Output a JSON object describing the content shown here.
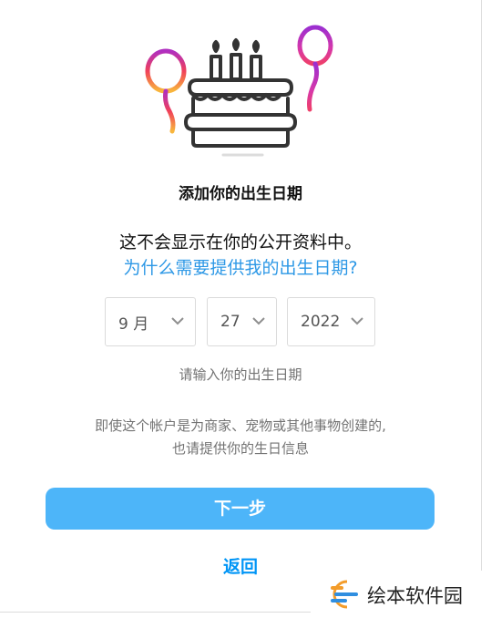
{
  "title": "添加你的出生日期",
  "description": "这不会显示在你的公开资料中。",
  "why_link": "为什么需要提供我的出生日期?",
  "birthday": {
    "month": "9 月",
    "day": "27",
    "year": "2022"
  },
  "hint": "请输入你的出生日期",
  "note_line1": "即使这个帐户是为商家、宠物或其他事物创建的,",
  "note_line2": "也请提供你的生日信息",
  "next_button": "下一步",
  "back_link": "返回",
  "watermark_text": "绘本软件园",
  "icons": {
    "illustration": "birthday-cake-icon",
    "balloon_left": "balloon-icon",
    "balloon_right": "balloon-icon",
    "chevron": "chevron-down-icon"
  },
  "colors": {
    "accent": "#0095f6",
    "link": "#2d98e6",
    "button": "#4db5f9",
    "muted": "#737373"
  }
}
